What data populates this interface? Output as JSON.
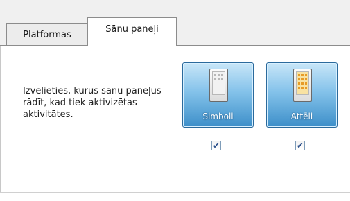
{
  "tabs": [
    {
      "label": "Platformas",
      "active": false
    },
    {
      "label": "Sānu paneļi",
      "active": true
    }
  ],
  "description": "Izvēlieties, kurus sānu paneļus rādīt, kad tiek aktivizētas aktivitātes.",
  "options": [
    {
      "label": "Simboli",
      "checked": true,
      "check_glyph": "✔",
      "icon": "device-symbols-icon"
    },
    {
      "label": "Attēli",
      "checked": true,
      "check_glyph": "✔",
      "icon": "device-images-icon"
    }
  ],
  "colors": {
    "button_top": "#c8e6f8",
    "button_bottom": "#3d8fc9",
    "image_accent": "#e79b26"
  }
}
